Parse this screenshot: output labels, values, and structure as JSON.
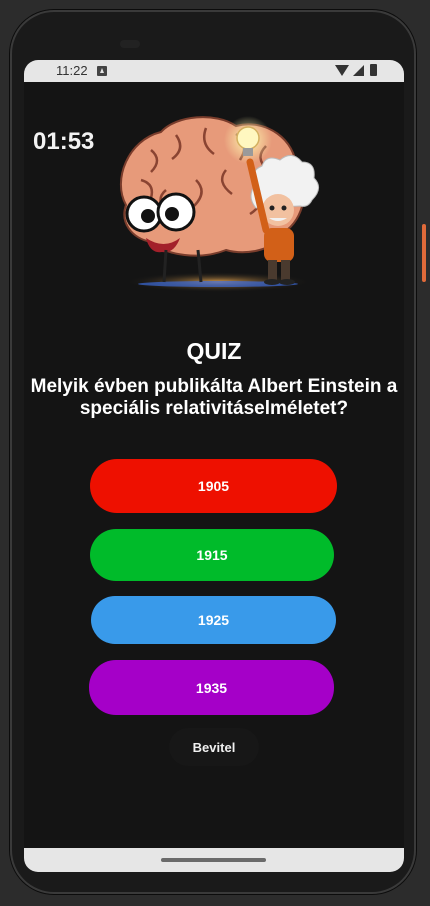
{
  "status_bar": {
    "time": "11:22"
  },
  "quiz": {
    "timer": "01:53",
    "title": "QUIZ",
    "question": "Melyik évben publikálta Albert Einstein a speciális relativitáselméletet?",
    "answers": [
      {
        "label": "1905",
        "color": "#ee1000"
      },
      {
        "label": "1915",
        "color": "#00bb2a"
      },
      {
        "label": "1925",
        "color": "#399aea"
      },
      {
        "label": "1935",
        "color": "#a500c8"
      }
    ],
    "submit_label": "Bevitel"
  },
  "icons": {
    "status_left": "a-notification-icon",
    "status_right": [
      "wifi-icon",
      "signal-icon",
      "battery-icon"
    ],
    "illustration": "brain-and-einstein-mascot"
  },
  "colors": {
    "screen_bg": "#141414",
    "text": "#ffffff"
  }
}
